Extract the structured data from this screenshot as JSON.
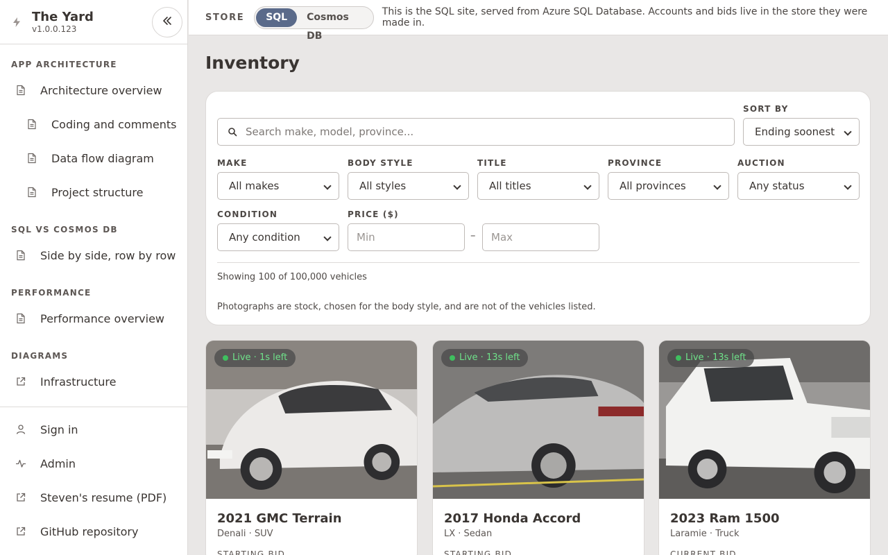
{
  "app": {
    "title": "The Yard",
    "version": "v1.0.0.123"
  },
  "sidebar": {
    "sections": [
      {
        "label": "APP ARCHITECTURE"
      },
      {
        "label": "SQL VS COSMOS DB"
      },
      {
        "label": "PERFORMANCE"
      },
      {
        "label": "DIAGRAMS"
      }
    ],
    "items": [
      {
        "label": "Architecture overview",
        "icon": "document-icon"
      },
      {
        "label": "Coding and comments",
        "icon": "document-icon"
      },
      {
        "label": "Data flow diagram",
        "icon": "document-icon"
      },
      {
        "label": "Project structure",
        "icon": "document-icon"
      },
      {
        "label": "Side by side, row by row",
        "icon": "document-icon"
      },
      {
        "label": "Performance overview",
        "icon": "document-icon"
      },
      {
        "label": "Infrastructure",
        "icon": "external-link-icon"
      }
    ],
    "footer_items": [
      {
        "label": "Sign in",
        "icon": "user-icon"
      },
      {
        "label": "Admin",
        "icon": "activity-icon"
      },
      {
        "label": "Steven's resume (PDF)",
        "icon": "external-link-icon"
      },
      {
        "label": "GitHub repository",
        "icon": "external-link-icon"
      }
    ]
  },
  "topbar": {
    "store_label": "STORE",
    "options": [
      "SQL",
      "Cosmos DB"
    ],
    "selected": "SQL",
    "description": "This is the SQL site, served from Azure SQL Database. Accounts and bids live in the store they were made in."
  },
  "page": {
    "title": "Inventory"
  },
  "filters": {
    "search_placeholder": "Search make, model, province...",
    "sort_label": "SORT BY",
    "sort_value": "Ending soonest",
    "make_label": "MAKE",
    "make_value": "All makes",
    "body_label": "BODY STYLE",
    "body_value": "All styles",
    "title_label": "TITLE",
    "title_value": "All titles",
    "province_label": "PROVINCE",
    "province_value": "All provinces",
    "auction_label": "AUCTION",
    "auction_value": "Any status",
    "condition_label": "CONDITION",
    "condition_value": "Any condition",
    "price_label": "PRICE ($)",
    "price_min_placeholder": "Min",
    "price_max_placeholder": "Max",
    "price_separator": "–",
    "showing": "Showing 100 of 100,000 vehicles",
    "disclaimer": "Photographs are stock, chosen for the body style, and are not of the vehicles listed."
  },
  "vehicles": [
    {
      "badge": "Live · 1s left",
      "title": "2021 GMC Terrain",
      "subtitle": "Denali · SUV",
      "bid_label": "STARTING BID"
    },
    {
      "badge": "Live · 13s left",
      "title": "2017 Honda Accord",
      "subtitle": "LX · Sedan",
      "bid_label": "STARTING BID"
    },
    {
      "badge": "Live · 13s left",
      "title": "2023 Ram 1500",
      "subtitle": "Laramie · Truck",
      "bid_label": "CURRENT BID"
    }
  ],
  "colors": {
    "accent": "#5a6a8a",
    "live_green": "#6fe28a"
  }
}
